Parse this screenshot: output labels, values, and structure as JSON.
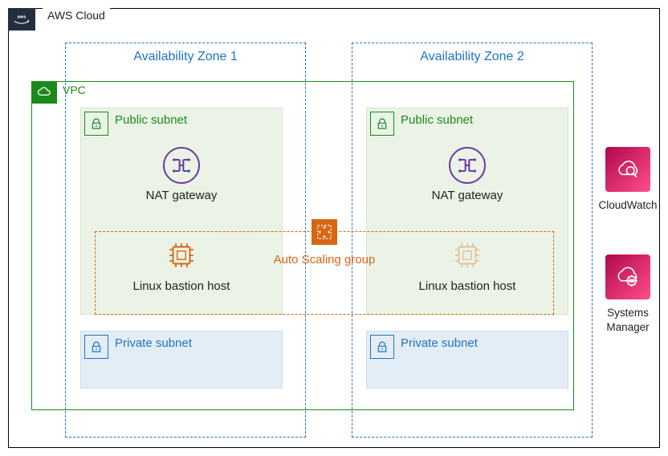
{
  "cloud": {
    "label": "AWS Cloud"
  },
  "vpc": {
    "label": "VPC"
  },
  "az": {
    "z1": "Availability Zone 1",
    "z2": "Availability Zone 2"
  },
  "subnet": {
    "public": "Public subnet",
    "private": "Private subnet"
  },
  "nat": {
    "caption": "NAT gateway"
  },
  "bastion": {
    "caption": "Linux bastion host"
  },
  "asg": {
    "label": "Auto Scaling group"
  },
  "services": {
    "cloudwatch": "CloudWatch",
    "ssm": "Systems Manager"
  },
  "colors": {
    "az_blue": "#2074c4",
    "vpc_green": "#1b8a1b",
    "asg_orange": "#d86613",
    "nat_purple": "#6b3fa0",
    "pink_start": "#b0084d",
    "pink_end": "#ff4f8b"
  }
}
